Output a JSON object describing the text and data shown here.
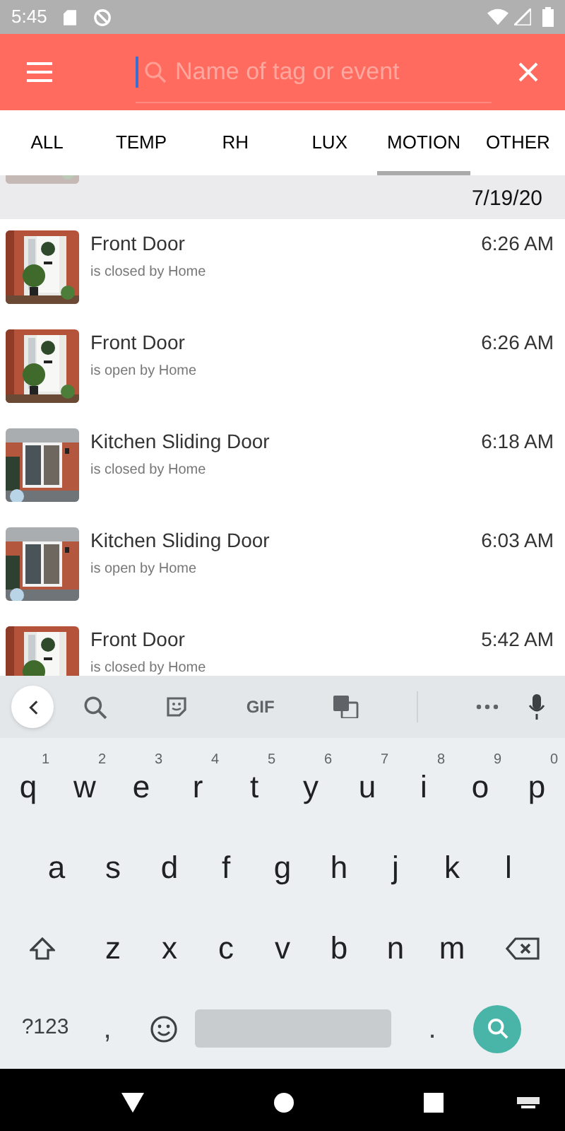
{
  "status_bar": {
    "time": "5:45"
  },
  "search": {
    "placeholder": "Name of tag or event"
  },
  "tabs": [
    {
      "label": "ALL",
      "selected": false
    },
    {
      "label": "TEMP",
      "selected": false
    },
    {
      "label": "RH",
      "selected": false
    },
    {
      "label": "LUX",
      "selected": false
    },
    {
      "label": "MOTION",
      "selected": true
    },
    {
      "label": "OTHER",
      "selected": false
    }
  ],
  "date_header": "7/19/20",
  "events": [
    {
      "name": "Front Door",
      "detail": "is closed by Home",
      "time": "6:26 AM",
      "kind": "front"
    },
    {
      "name": "Front Door",
      "detail": "is open by Home",
      "time": "6:26 AM",
      "kind": "front"
    },
    {
      "name": "Kitchen Sliding Door",
      "detail": "is closed by Home",
      "time": "6:18 AM",
      "kind": "sliding"
    },
    {
      "name": "Kitchen Sliding Door",
      "detail": "is open by Home",
      "time": "6:03 AM",
      "kind": "sliding"
    },
    {
      "name": "Front Door",
      "detail": "is closed by Home",
      "time": "5:42 AM",
      "kind": "front"
    }
  ],
  "keyboard": {
    "gif": "GIF",
    "row_1": [
      {
        "key": "q",
        "hint": "1"
      },
      {
        "key": "w",
        "hint": "2"
      },
      {
        "key": "e",
        "hint": "3"
      },
      {
        "key": "r",
        "hint": "4"
      },
      {
        "key": "t",
        "hint": "5"
      },
      {
        "key": "y",
        "hint": "6"
      },
      {
        "key": "u",
        "hint": "7"
      },
      {
        "key": "i",
        "hint": "8"
      },
      {
        "key": "o",
        "hint": "9"
      },
      {
        "key": "p",
        "hint": "0"
      }
    ],
    "row_2": [
      "a",
      "s",
      "d",
      "f",
      "g",
      "h",
      "j",
      "k",
      "l"
    ],
    "row_3": [
      "z",
      "x",
      "c",
      "v",
      "b",
      "n",
      "m"
    ],
    "symbols": "?123",
    "comma": ",",
    "period": "."
  }
}
